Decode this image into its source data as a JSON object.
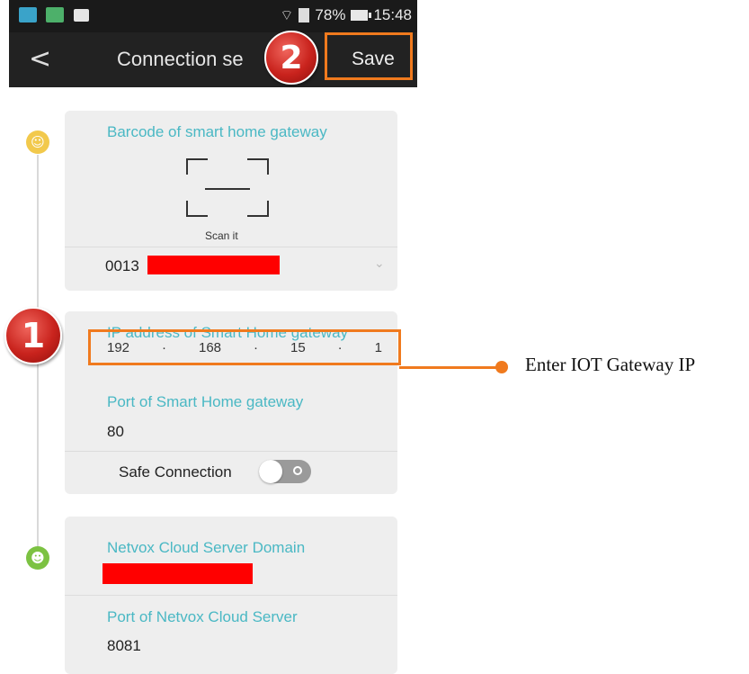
{
  "status_bar": {
    "signal_text": "78%",
    "time": "15:48",
    "icons": [
      "notification-app-icon",
      "notification-app-icon",
      "image-icon",
      "wifi-icon",
      "sd-card-icon",
      "battery-icon"
    ]
  },
  "header": {
    "back_glyph": "<",
    "title": "Connection se",
    "save_label": "Save"
  },
  "badges": {
    "one": "1",
    "two": "2"
  },
  "gateway_barcode": {
    "label": "Barcode of smart home gateway",
    "scan_label": "Scan it",
    "barcode_prefix": "0013"
  },
  "gateway_network": {
    "ip_label": "IP address of Smart Home gateway",
    "ip_octets": [
      "192",
      "168",
      "15",
      "1"
    ],
    "ip_separator": "·",
    "port_label": "Port of Smart Home gateway",
    "port_value": "80",
    "safe_connection_label": "Safe Connection",
    "safe_connection_on": false
  },
  "cloud": {
    "domain_label": "Netvox Cloud Server Domain",
    "port_label": "Port of Netvox Cloud Server",
    "port_value": "8081"
  },
  "callout": {
    "bold": "Enter",
    "rest": " IOT Gateway IP"
  },
  "colors": {
    "accent_orange": "#f07a1e",
    "label_teal": "#4ab8c4",
    "redaction_red": "#ff0000",
    "badge_red": "#c9231d"
  }
}
